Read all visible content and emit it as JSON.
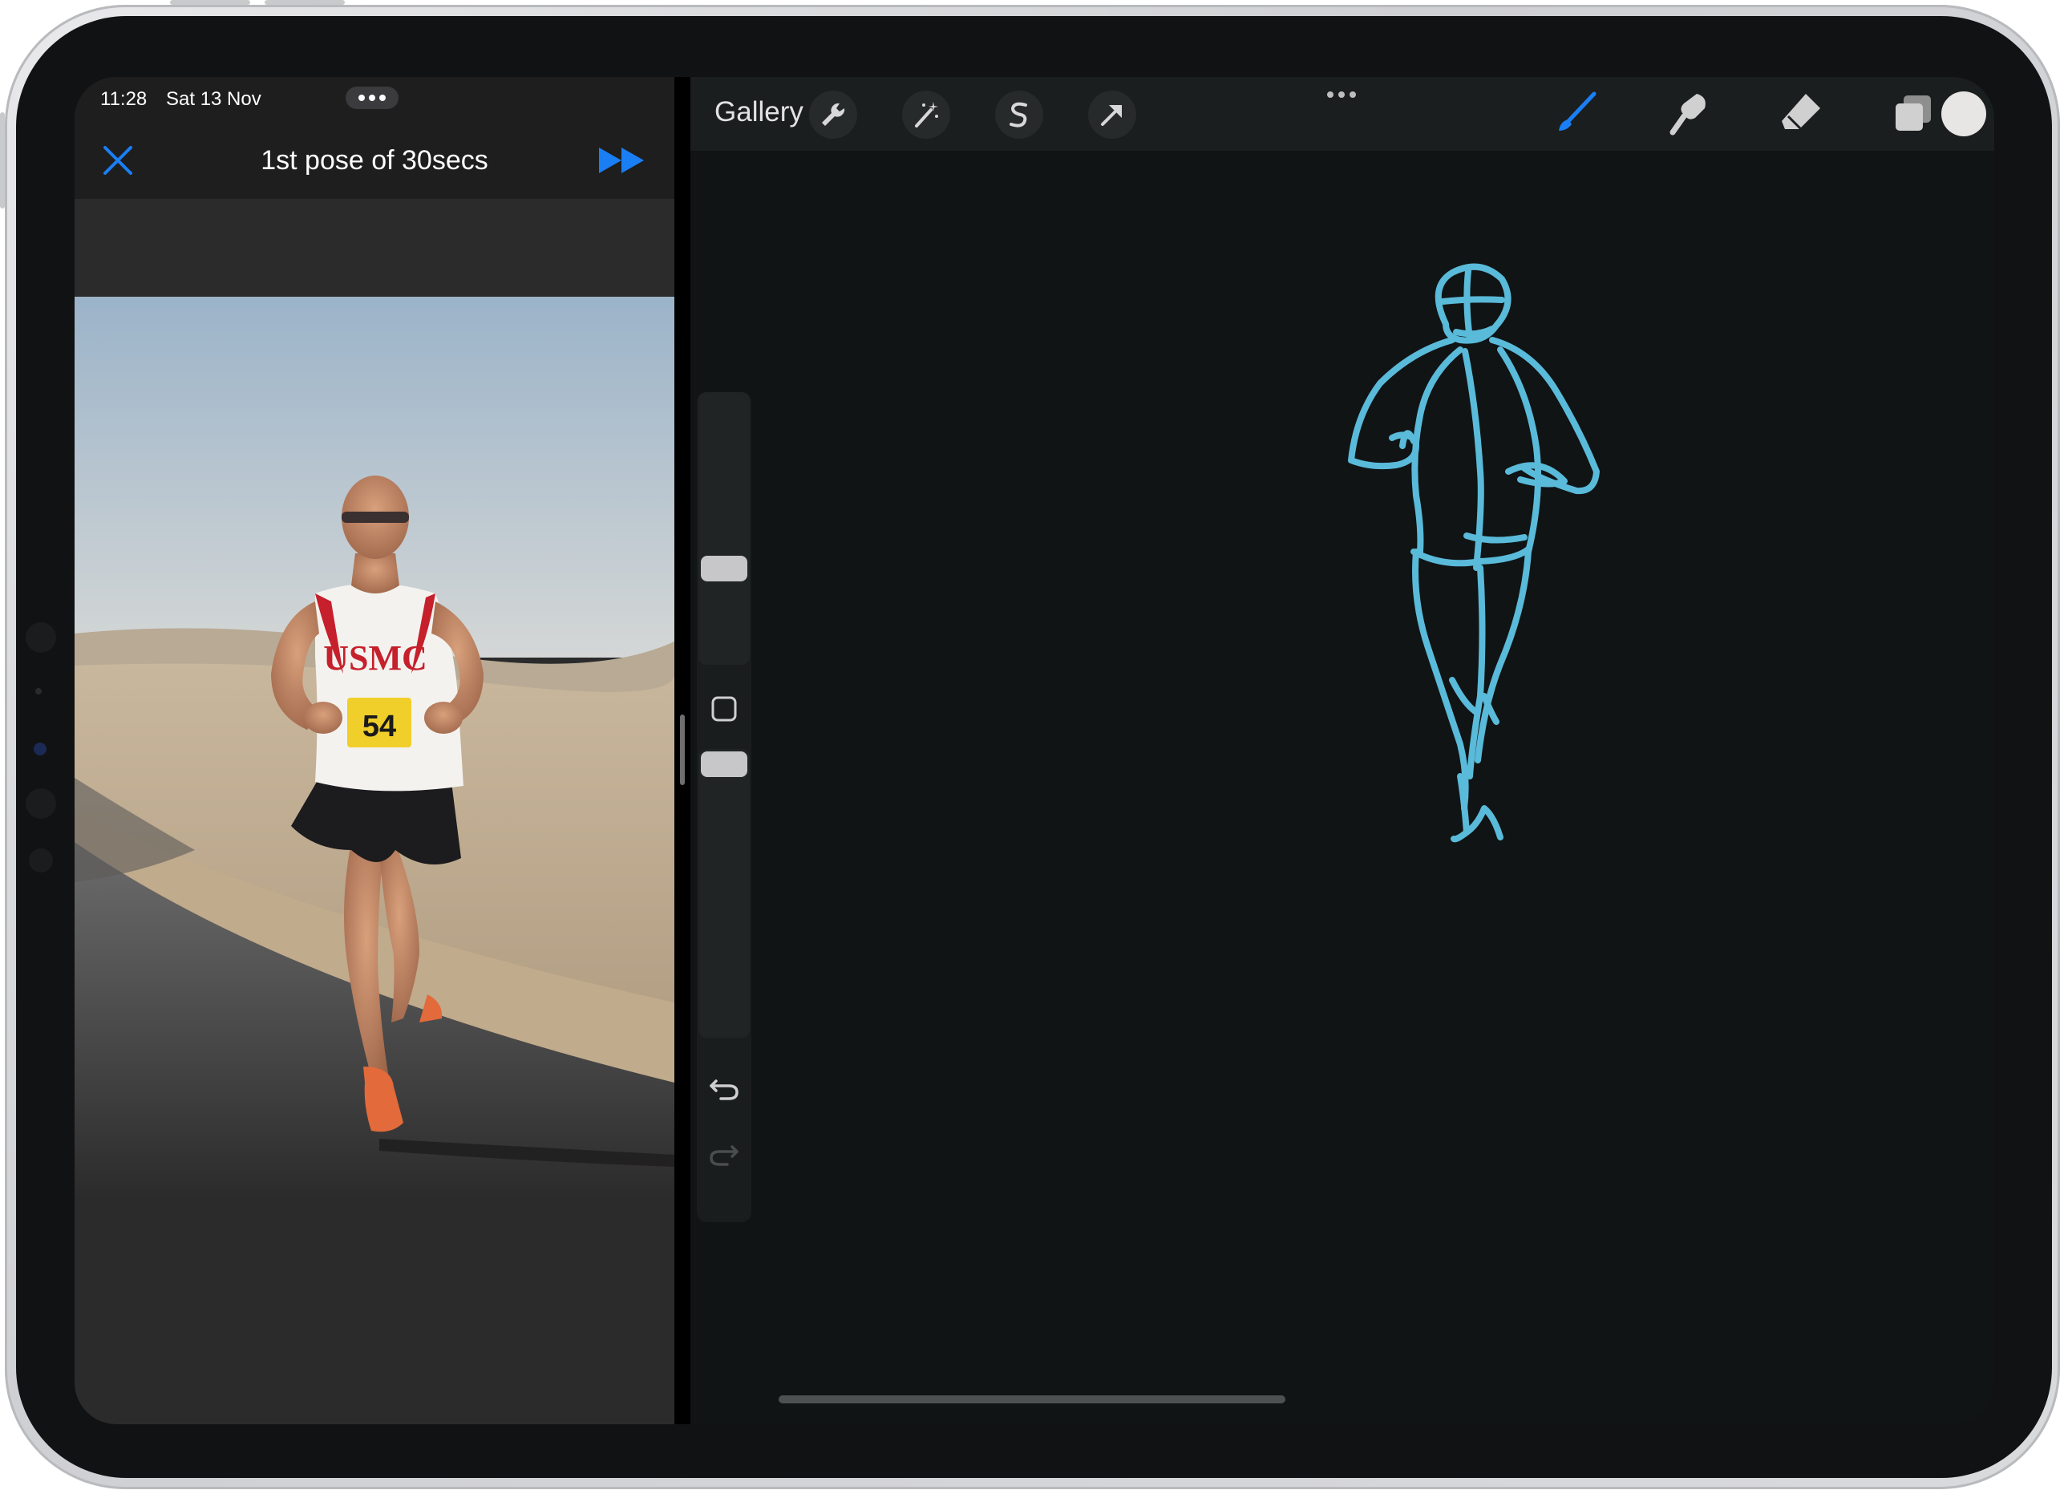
{
  "status_bar": {
    "time": "11:28",
    "date": "Sat 13 Nov"
  },
  "timer_app": {
    "title": "1st pose of 30secs",
    "accent_color": "#1a7ff5",
    "photo": {
      "shirt_text": "USMC",
      "bib_number": "54"
    }
  },
  "procreate": {
    "gallery_label": "Gallery",
    "left_tools": [
      "wrench-icon",
      "magic-wand-icon",
      "selection-icon",
      "transform-arrow-icon"
    ],
    "right_tools": [
      "brush-icon",
      "smudge-icon",
      "eraser-icon",
      "layers-icon"
    ],
    "active_tool": "brush-icon",
    "current_color": "#e8e6e4",
    "stroke_color": "#5fc3e4"
  }
}
